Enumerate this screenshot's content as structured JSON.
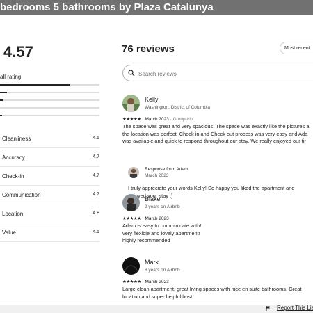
{
  "window": {
    "title": "bedrooms 5 bathrooms by Plaza Catalunya"
  },
  "summary": {
    "overall_rating": "4.57",
    "overall_label": "all rating",
    "distribution": [
      0.78,
      0.08,
      0.03,
      0.0,
      0.02
    ]
  },
  "categories": [
    {
      "label": "Cleanliness",
      "value": "4.5"
    },
    {
      "label": "Accuracy",
      "value": "4.7"
    },
    {
      "label": "Check-in",
      "value": "4.7"
    },
    {
      "label": "Communication",
      "value": "4.7"
    },
    {
      "label": "Location",
      "value": "4.8"
    },
    {
      "label": "Value",
      "value": "4.5"
    }
  ],
  "reviews_header": {
    "title": "76 reviews",
    "sort_label": "Most recent"
  },
  "search": {
    "placeholder": "Search reviews"
  },
  "reviews": [
    {
      "name": "Kelly",
      "subtitle": "Washington, District of Columbia",
      "stars": "★★★★★",
      "date": "March 2023",
      "trip": "Group trip",
      "text_lines": [
        "The space was great and very spacious. The space was exactly like the pictures a",
        "the location was perfect! Check in and Check out process was very easy and Ada",
        "was available and quick to respond throughout our stay. We really enjoyed our tir"
      ],
      "response": {
        "from": "Response from Adam",
        "date": "March 2023",
        "text_lines": [
          "I truly appreciate your words Kelly! So happy you liked the apartment and",
          "enjoyed your stay :)"
        ]
      }
    },
    {
      "name": "Blake",
      "subtitle": "9 years on Airbnb",
      "stars": "★★★★★",
      "date": "March 2023",
      "text_lines": [
        "Adam is easy to comminicate with!",
        "very flexible and lovely apartment!",
        "highly recommended"
      ]
    },
    {
      "name": "Mark",
      "subtitle": "8 years on Airbnb",
      "stars": "★★★★★",
      "date": "March 2023",
      "text_lines": [
        "Large clean apartment, great living spaces with nice en suite bathrooms. Great",
        "location and super helpful host."
      ]
    }
  ],
  "footer": {
    "report_label": "Report This Lis"
  },
  "colors": {
    "text": "#222222",
    "muted": "#717171",
    "bar_fill": "#222222",
    "bar_track": "#dddddd"
  }
}
